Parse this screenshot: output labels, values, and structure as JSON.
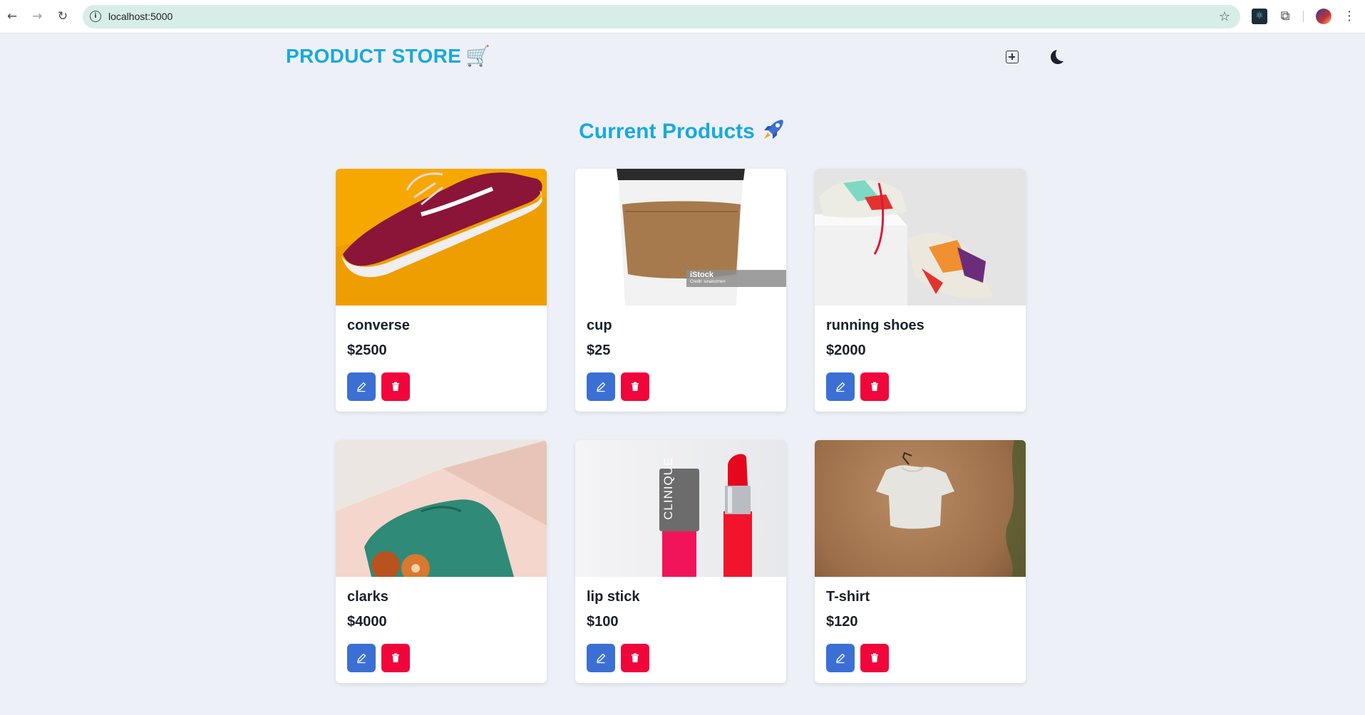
{
  "browser": {
    "url": "localhost:5000"
  },
  "header": {
    "logo_text": "PRODUCT STORE",
    "logo_icon": "shopping-cart-icon",
    "add_icon": "plus-square-icon",
    "theme_icon": "moon-icon"
  },
  "main": {
    "title": "Current Products",
    "title_icon": "rocket-icon"
  },
  "products": [
    {
      "name": "converse",
      "price": "$2500"
    },
    {
      "name": "cup",
      "price": "$25"
    },
    {
      "name": "running shoes",
      "price": "$2000"
    },
    {
      "name": "clarks",
      "price": "$4000"
    },
    {
      "name": "lip stick",
      "price": "$100"
    },
    {
      "name": "T-shirt",
      "price": "$120"
    }
  ],
  "image_text": {
    "cup_watermark": "iStock",
    "cup_credit": "Credit: sinalozmen",
    "lipstick_brand": "CLINIQUE"
  },
  "colors": {
    "accent": "#19a9dc",
    "edit_button": "#3b6fd4",
    "delete_button": "#f0063a",
    "page_background": "#edf1f7"
  }
}
